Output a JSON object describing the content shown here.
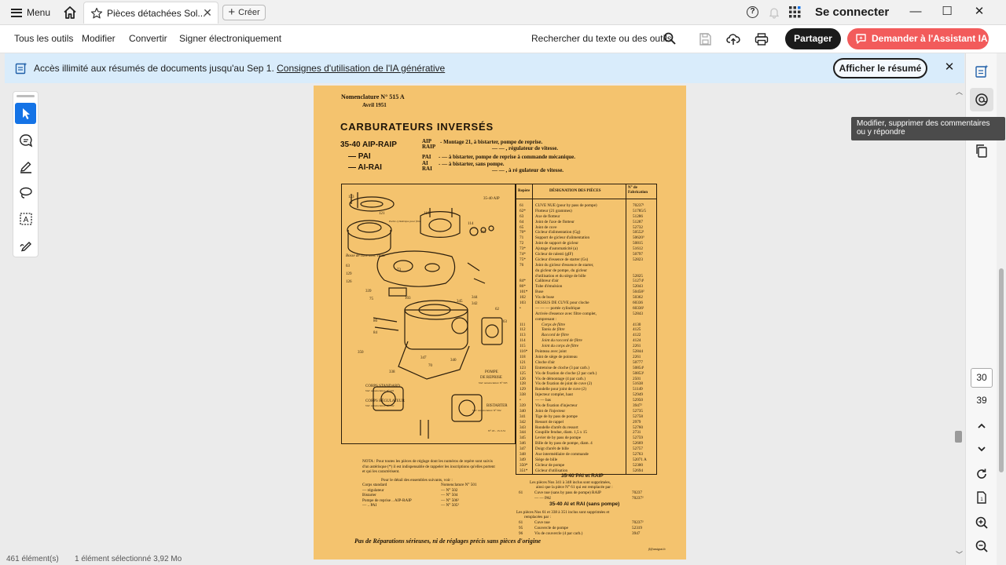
{
  "titlebar": {
    "menu_label": "Menu",
    "tab_title": "Pièces détachées Sol...",
    "create_label": "Créer",
    "sign_in": "Se connecter",
    "help_icon": "?",
    "win_min": "—",
    "win_max": "☐",
    "win_close": "✕"
  },
  "toolbar": {
    "items": [
      "Tous les outils",
      "Modifier",
      "Convertir",
      "Signer électroniquement"
    ],
    "search_label": "Rechercher du texte ou des outils",
    "share_label": "Partager",
    "ai_label": "Demander à l'Assistant IA",
    "colors": {
      "share_bg": "#1b1b1b",
      "ai_bg": "#f25b5b",
      "accent": "#1473e6"
    }
  },
  "banner": {
    "text": "Accès illimité aux résumés de documents jusqu'au Sep 1. ",
    "link": "Consignes d'utilisation de l'IA générative",
    "button": "Afficher le résumé",
    "close": "✕"
  },
  "left_tools": [
    "cursor-icon",
    "comment-icon",
    "highlight-pen-icon",
    "lasso-icon",
    "text-select-icon",
    "sign-pen-icon"
  ],
  "right_panel": {
    "page_current": "30",
    "page_total": "39",
    "tooltip": "Modifier, supprimer des commentaires ou y répondre"
  },
  "statusbar": {
    "count": "461 élément(s)",
    "selected": "1 élément sélectionné 3,92 Mo"
  },
  "doc": {
    "nomenclature": "Nomenclature N° 515 A",
    "date": "Avril 1951",
    "title": "CARBURATEURS  INVERSÉS",
    "models": [
      {
        "name": "35-40 AIP-RAIP",
        "variants": "AIP\nRAIP",
        "desc": "- Montage 21, à bistarter, pompe de reprise.",
        "desc2": "—       —       , régulateur de vitesse."
      },
      {
        "name": "—     PAI",
        "variants": "PAI",
        "desc": "-    —       à bistarter, pompe de reprise à commande mécanique."
      },
      {
        "name": "—   AI-RAI",
        "variants": "AI\nRAI",
        "desc": "-    —       à bistarter, sans pompe.",
        "desc2": "—       —       , à ré gulateur de vitesse."
      }
    ],
    "diagram": {
      "model_label": "35-40 AIP",
      "label_pompe": "POMPE\nDE REPRISE",
      "label_corps_standard": "CORPS STANDARD",
      "label_corps_regulateur": "CORPS RÉGULATEUR",
      "label_bistarter": "BISTARTER",
      "label_nomen_501": "Voir nomenclature N° 501",
      "label_nomen_502": "Voir nomenclature N° 502",
      "label_nomen_504": "Voir nomenclature N° 504",
      "label_nomen_505": "Voir nomenclature N° 505",
      "label_bosse": "Bosse de cuve avec chute",
      "label_partie": "Partie cylindrique pour filtre",
      "label_ref": "N° 43 - 15-3-51"
    },
    "table_headers": {
      "repere": "Repère",
      "designation": "DÉSIGNATION DES PIÈCES",
      "fab": "N° de Fabrication"
    },
    "parts": [
      [
        "61",
        "CUVE NUE (pour by pass de pompe)",
        "70237¹"
      ],
      [
        "62*",
        "Flotteur (21 grammes)",
        "51785/5"
      ],
      [
        "63",
        "Axe de flotteur",
        "51286"
      ],
      [
        "64",
        "Joint de l'axe de flotteur",
        "51287"
      ],
      [
        "65",
        "Joint de cuve",
        "52732"
      ],
      [
        "70*",
        "Gicleur d'alimentation (Gg)",
        "50552¹"
      ],
      [
        "71",
        "Support de gicleur d'alimentation",
        "50620³"
      ],
      [
        "72",
        "Joint de support de gicleur",
        "50815"
      ],
      [
        "73*",
        "Ajutage d'automaticité (a)",
        "51612"
      ],
      [
        "74*",
        "Gicleur de ralenti (gIF)",
        "50797"
      ],
      [
        "75*",
        "Gicleur d'essence de starter (Gs)",
        "52823"
      ],
      [
        "76",
        "Joint du gicleur d'essence de starter,",
        ""
      ],
      [
        "",
        "du gicleur de pompe, du gicleur",
        ""
      ],
      [
        "",
        "d'utilisation et du siège de bille",
        "52825"
      ],
      [
        "84*",
        "Calibreur d'air",
        "51274¹"
      ],
      [
        "86*",
        "Tube d'émulsion",
        "52043"
      ],
      [
        "101*",
        "Buse",
        "50458²"
      ],
      [
        "102",
        "Vis de buse",
        "50362"
      ],
      [
        "103",
        "DESSUS DE CUVE pour cloche",
        "60336"
      ],
      [
        "•",
        "—  —  — portée cylindrique",
        "60336¹"
      ],
      [
        "",
        "Arrivée d'essence avec filtre complet,",
        "52843"
      ],
      [
        "",
        "comprenant :",
        ""
      ],
      [
        "111",
        "Corps de filtre",
        "4130"
      ],
      [
        "112",
        "Tamis de filtre",
        "4125"
      ],
      [
        "113",
        "Raccord de filtre",
        "4122"
      ],
      [
        "114",
        "Joint du raccord de filtre",
        "4124"
      ],
      [
        "115",
        "Joint du corps de filtre",
        "2261"
      ],
      [
        "116*",
        "Pointeau avec joint",
        "52844"
      ],
      [
        "118",
        "Joint de siège de pointeau",
        "2261"
      ],
      [
        "121",
        "Cloche d'air",
        "50777"
      ],
      [
        "123",
        "Entretoise de cloche (3 par carb.)",
        "50854¹"
      ],
      [
        "125",
        "Vis de fixation de cloche (2 par carb.)",
        "50853¹"
      ],
      [
        "126",
        "Vis de démontage (4 par carb.)",
        "2501"
      ],
      [
        "128",
        "Vis de fixation de joint de cuve (2)",
        "51638"
      ],
      [
        "129",
        "Rondelle pour joint de cuve (2)",
        "51149"
      ],
      [
        "338",
        "Injecteur complet, haut",
        "52949"
      ],
      [
        "•",
        "—  —  bas",
        "52950"
      ],
      [
        "339",
        "Vis de fixation d'injecteur",
        "3947²"
      ],
      [
        "340",
        "Joint de l'injecteur",
        "52735"
      ],
      [
        "341",
        "Tige de by pass de pompe",
        "52758"
      ],
      [
        "342",
        "Ressort de rappel",
        "2979"
      ],
      [
        "343",
        "Rondelle d'arrêt du ressort",
        "52760"
      ],
      [
        "344",
        "Goupille fendue, diam. 1,5 x 15",
        "2731"
      ],
      [
        "345",
        "Levier de by pass de pompe",
        "52759"
      ],
      [
        "346",
        "Bille de by pass de pompe, diam. 4",
        "52669"
      ],
      [
        "347",
        "Doigt d'arrêt de bille",
        "52757"
      ],
      [
        "348",
        "Axe intermédiaire de commande",
        "52763"
      ],
      [
        "349",
        "Siège de bille",
        "52071 A"
      ],
      [
        "350*",
        "Gicleur de pompe",
        "52300"
      ],
      [
        "351*",
        "Gicleur d'utilisation",
        "52694"
      ]
    ],
    "pai_title": "35-40 PAI et RAIP",
    "pai_text": "Les pièces Nos 341 à 348 inclus sont supprimées,",
    "pai_text2": "ainsi que la pièce N° 61 qui est remplacée par :",
    "pai_rows": [
      [
        "61",
        "Cuve nue (sans by pass de pompe) RAIP",
        "70237"
      ],
      [
        "",
        "—  —  PAI",
        "70237²"
      ]
    ],
    "ai_title": "35-40 AI et RAI (sans pompe)",
    "ai_text": "Les pièces Nos 61 et 338 à 351 inclus sont supprimées et",
    "ai_text2": "remplacées par :",
    "ai_rows": [
      [
        "61",
        "Cuve nue",
        "70237²"
      ],
      [
        "95",
        "Couvercle de pompe",
        "52319"
      ],
      [
        "96",
        "Vis de couvercle (4 par carb.)",
        "3947"
      ]
    ],
    "nota": "NOTA : Pour toutes les pièces de réglage dont les numéros de repère sont suivis d'un astérisque (*) il est indispensable de rappeler les inscriptions qu'elles portent et qui les caractérisent.",
    "nota2": "Pour le détail des ensembles suivants, voir :",
    "nota_rows": [
      [
        "Corps standard",
        "Nomenclature N° 501"
      ],
      [
        "— régulateur",
        "—  N° 502"
      ],
      [
        "Bistarter",
        "—  N° 504"
      ],
      [
        "Pompe de reprise .. AIP-RAIP",
        "—  N° 506²"
      ],
      [
        "— .. PAI",
        "—  N° 505²"
      ]
    ],
    "footer": "Pas de Réparations sérieuses, ni de réglages précis sans pièces d'origine",
    "credit": "jl@amigrat.fr"
  }
}
